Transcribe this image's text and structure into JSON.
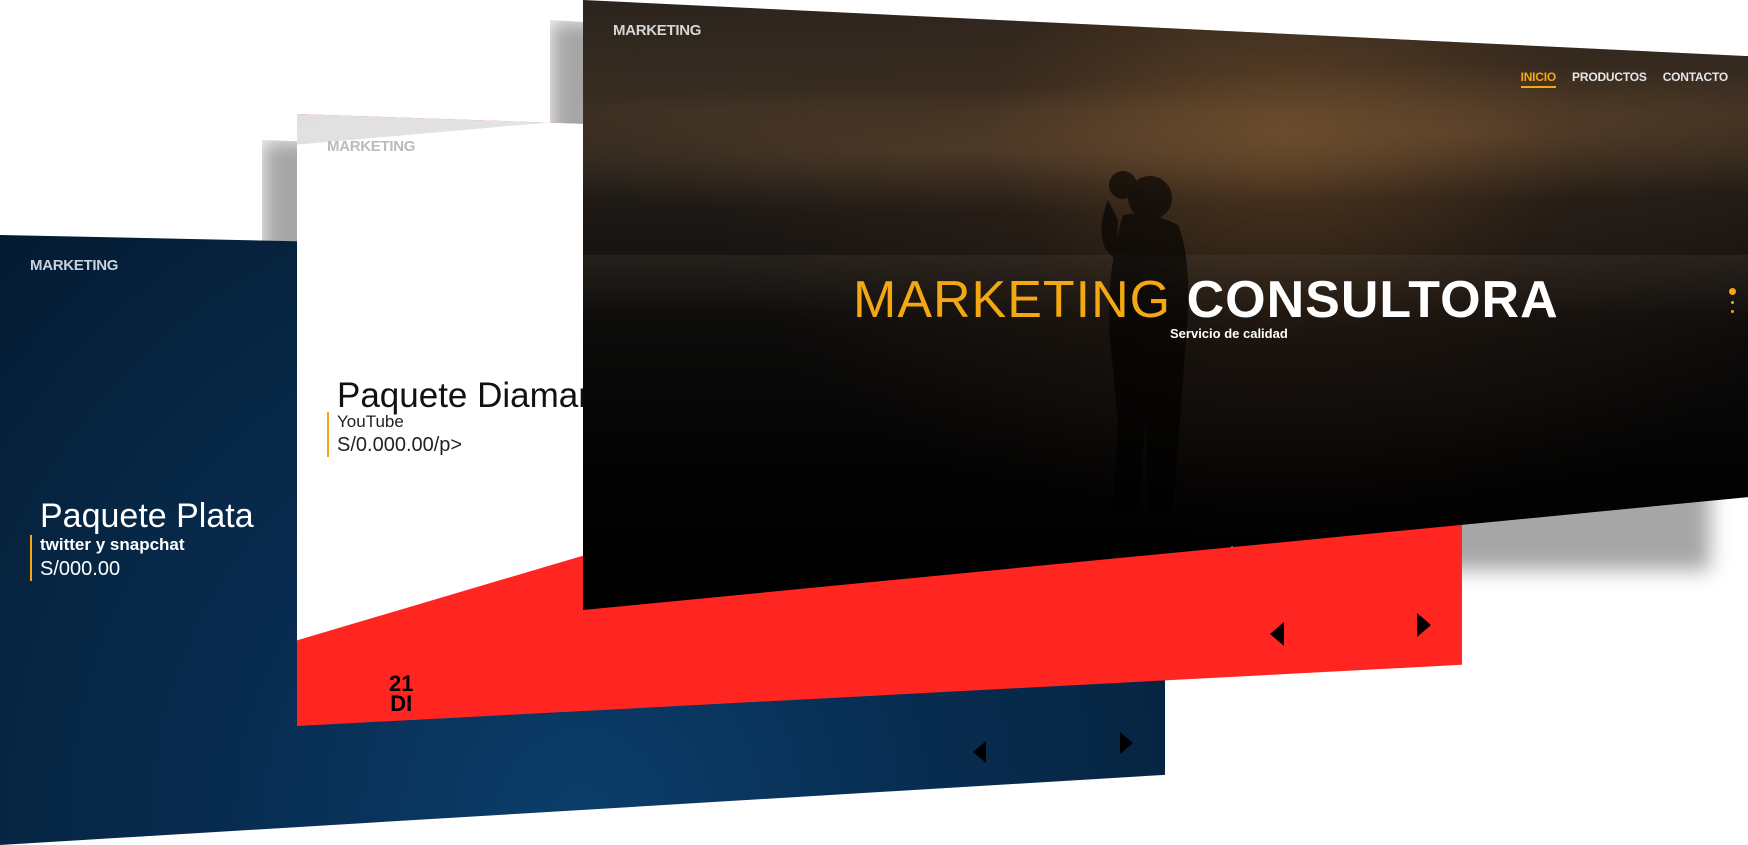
{
  "cards": {
    "blue": {
      "brand": "MARKETING",
      "package_title": "Paquete Plata",
      "networks": "twitter y snapchat",
      "price": "S/000.00"
    },
    "red": {
      "brand": "MARKETING",
      "package_title": "Paquete Diamante",
      "networks": "YouTube",
      "price": "S/0.000.00/p>",
      "day_number": "21",
      "day_label": "DI"
    },
    "hero": {
      "brand": "MARKETING",
      "nav": [
        "INICIO",
        "PRODUCTOS",
        "CONTACTO"
      ],
      "title_part1": "MARKETING",
      "title_part2": "CONSULTORA",
      "subtitle": "Servicio de calidad"
    }
  },
  "colors": {
    "accent": "#f3a712",
    "red": "#ff2622",
    "navy": "#062440"
  },
  "icons": [
    "arrow-left-icon",
    "arrow-right-icon",
    "chevron-down-icon"
  ]
}
